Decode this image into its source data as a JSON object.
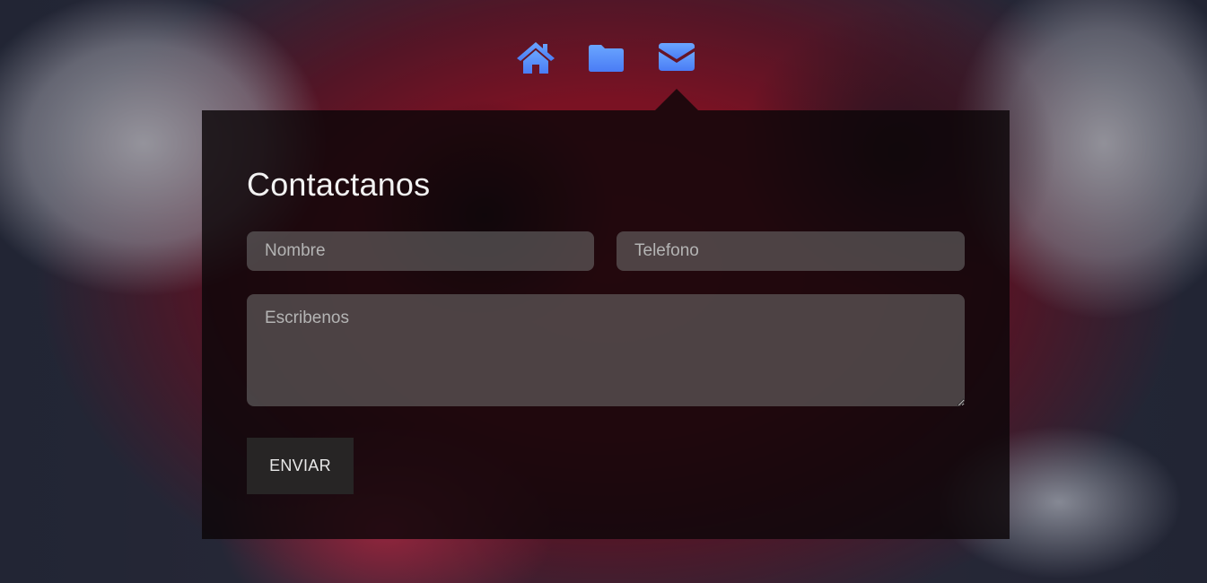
{
  "colors": {
    "icon_gradient_top": "#6aa6ff",
    "icon_gradient_bottom": "#4a7cf5",
    "panel_bg": "rgba(12,6,8,0.82)",
    "field_bg": "rgba(115,115,115,0.55)",
    "button_bg": "#272525"
  },
  "nav": {
    "items": [
      {
        "icon": "home-icon",
        "active": false
      },
      {
        "icon": "folder-icon",
        "active": false
      },
      {
        "icon": "envelope-icon",
        "active": true
      }
    ]
  },
  "contact": {
    "title": "Contactanos",
    "name_placeholder": "Nombre",
    "phone_placeholder": "Telefono",
    "message_placeholder": "Escribenos",
    "submit_label": "ENVIAR"
  }
}
